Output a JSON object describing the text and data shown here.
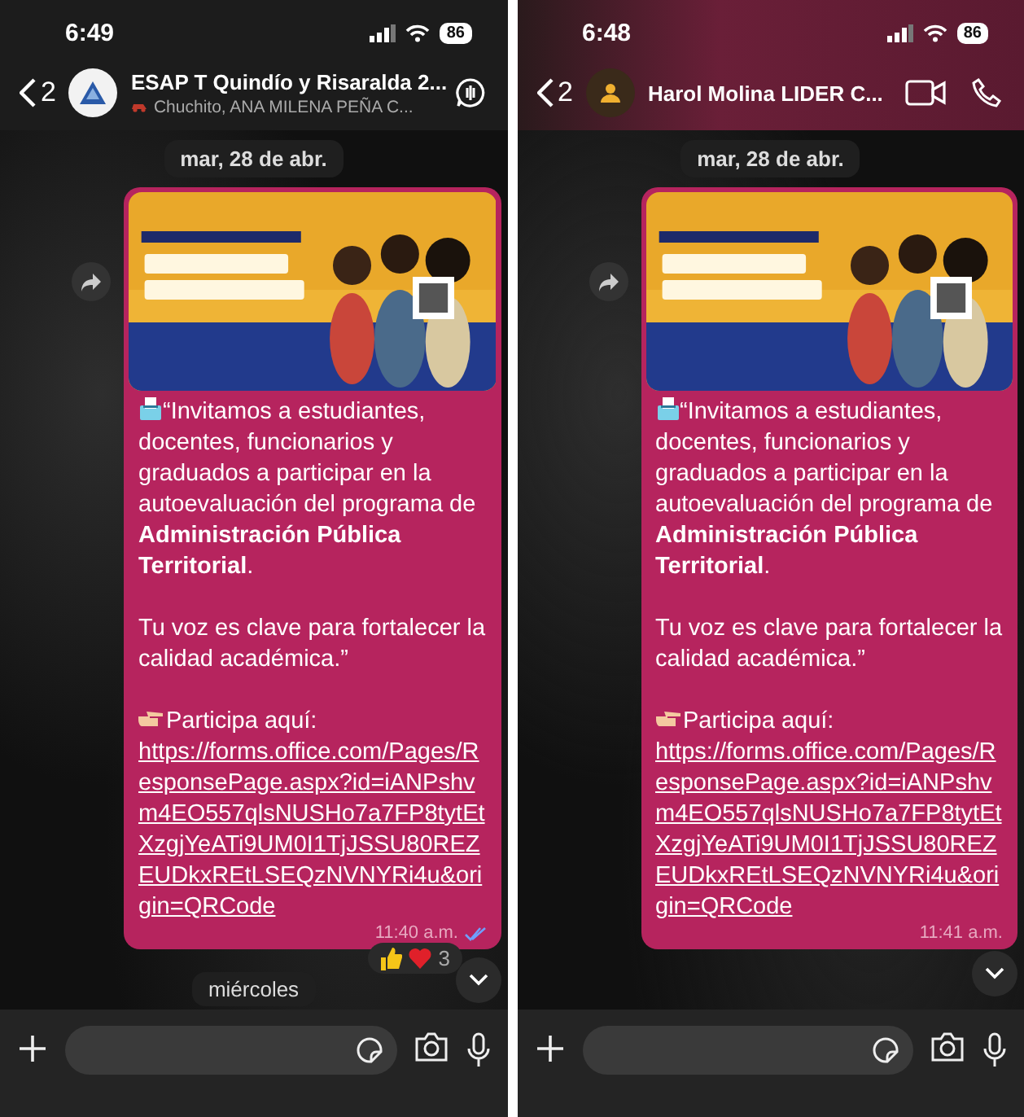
{
  "panels": [
    {
      "status": {
        "time": "6:49",
        "battery": "86"
      },
      "header": {
        "back_count": "2",
        "title": "ESAP T Quindío y Risaralda 2...",
        "subtitle": "Chuchito, ANA MILENA PEÑA C...",
        "kind": "group",
        "avatar": {
          "kind": "logo"
        },
        "actions": [
          {
            "kind": "voice-chat"
          }
        ]
      },
      "date_chip": "mar, 28 de abr.",
      "message": {
        "paragraphs": [
          "“Invitamos a estudiantes, docentes, funcionarios y graduados a participar en la autoevaluación del programa de **Administración Pública Territorial**.",
          "Tu voz es clave para fortalecer la calidad académica.”"
        ],
        "cta": "Participa aquí: ",
        "link": "https://forms.office.com/Pages/ResponsePage.aspx?id=iANPshvm4EO557qlsNUSHo7a7FP8tytEtXzgjYeATi9UM0I1TjJSSU80REZEUDkxREtLSEQzNVNYRi4u&origin=QRCode",
        "time": "11:40 a.m.",
        "read": true
      },
      "reactions": {
        "count": "3"
      },
      "next_date": "miércoles"
    },
    {
      "status": {
        "time": "6:48",
        "battery": "86"
      },
      "header": {
        "back_count": "2",
        "title": "Harol Molina LIDER C...",
        "kind": "contact",
        "avatar": {
          "kind": "person"
        },
        "actions": [
          {
            "kind": "video-call"
          },
          {
            "kind": "voice-call"
          }
        ]
      },
      "date_chip": "mar, 28 de abr.",
      "message": {
        "paragraphs": [
          "“Invitamos a estudiantes, docentes, funcionarios y graduados a participar en la autoevaluación del programa de **Administración Pública Territorial**.",
          "Tu voz es clave para fortalecer la calidad académica.”"
        ],
        "cta": "Participa aquí: ",
        "link": "https://forms.office.com/Pages/ResponsePage.aspx?id=iANPshvm4EO557qlsNUSHo7a7FP8tytEtXzgjYeATi9UM0I1TjJSSU80REZEUDkxREtLSEQzNVNYRi4u&origin=QRCode",
        "time": "11:41 a.m.",
        "read": false
      }
    }
  ]
}
